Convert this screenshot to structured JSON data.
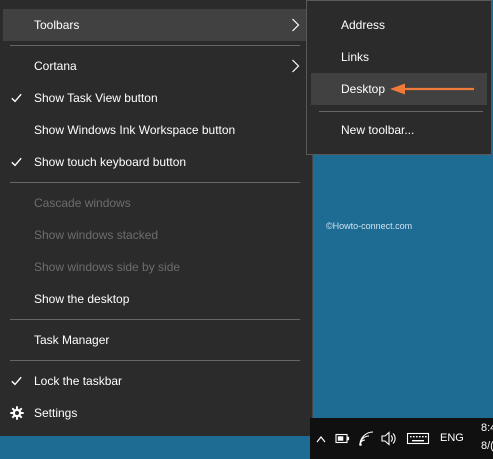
{
  "menu": {
    "toolbars_label": "Toolbars",
    "cortana_label": "Cortana",
    "show_task_view_label": "Show Task View button",
    "show_ink_workspace_label": "Show Windows Ink Workspace button",
    "show_touch_keyboard_label": "Show touch keyboard button",
    "cascade_label": "Cascade windows",
    "stacked_label": "Show windows stacked",
    "side_by_side_label": "Show windows side by side",
    "show_desktop_label": "Show the desktop",
    "task_manager_label": "Task Manager",
    "lock_taskbar_label": "Lock the taskbar",
    "settings_label": "Settings"
  },
  "submenu": {
    "address_label": "Address",
    "links_label": "Links",
    "desktop_label": "Desktop",
    "new_toolbar_label": "New toolbar..."
  },
  "watermark": "©Howto-connect.com",
  "taskbar": {
    "language": "ENG",
    "time_partial": "8:4",
    "date_partial": "8/("
  },
  "colors": {
    "menu_bg": "#2b2b2b",
    "hover_bg": "#414141",
    "disabled_text": "#6d6d6d",
    "annotation_arrow": "#f07a3a",
    "desktop_bg": "#1e6b94"
  }
}
